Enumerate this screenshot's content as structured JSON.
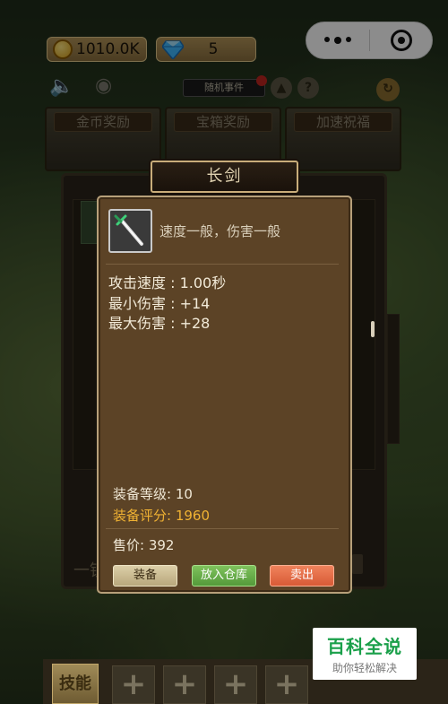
{
  "status": {
    "gold": "1010.0K",
    "gems": "5"
  },
  "header": {
    "event_tag": "随机事件"
  },
  "rewards": {
    "tabs": [
      "金币奖励",
      "宝箱奖励",
      "加速祝福"
    ]
  },
  "item": {
    "title": "长剑",
    "description": "速度一般，伤害一般",
    "stats": [
      "攻击速度 : 1.00秒",
      "最小伤害 : +14",
      "最大伤害 : +28"
    ],
    "level": "装备等级: 10",
    "rating": "装备评分: 1960",
    "price": "售价:  392",
    "actions": {
      "equip": "装备",
      "store": "放入仓库",
      "sell": "卖出"
    }
  },
  "background_panel": {
    "left_text": "一锁"
  },
  "skills": {
    "label": "技能",
    "slots": [
      "+",
      "+",
      "+",
      "+"
    ]
  },
  "watermark": {
    "main": "百科全说",
    "sub": "助你轻松解决"
  },
  "colors": {
    "popup_bg": "#5c4326",
    "rating_color": "#f0b233",
    "store_button": "#549a3a",
    "sell_button": "#d85a36"
  }
}
